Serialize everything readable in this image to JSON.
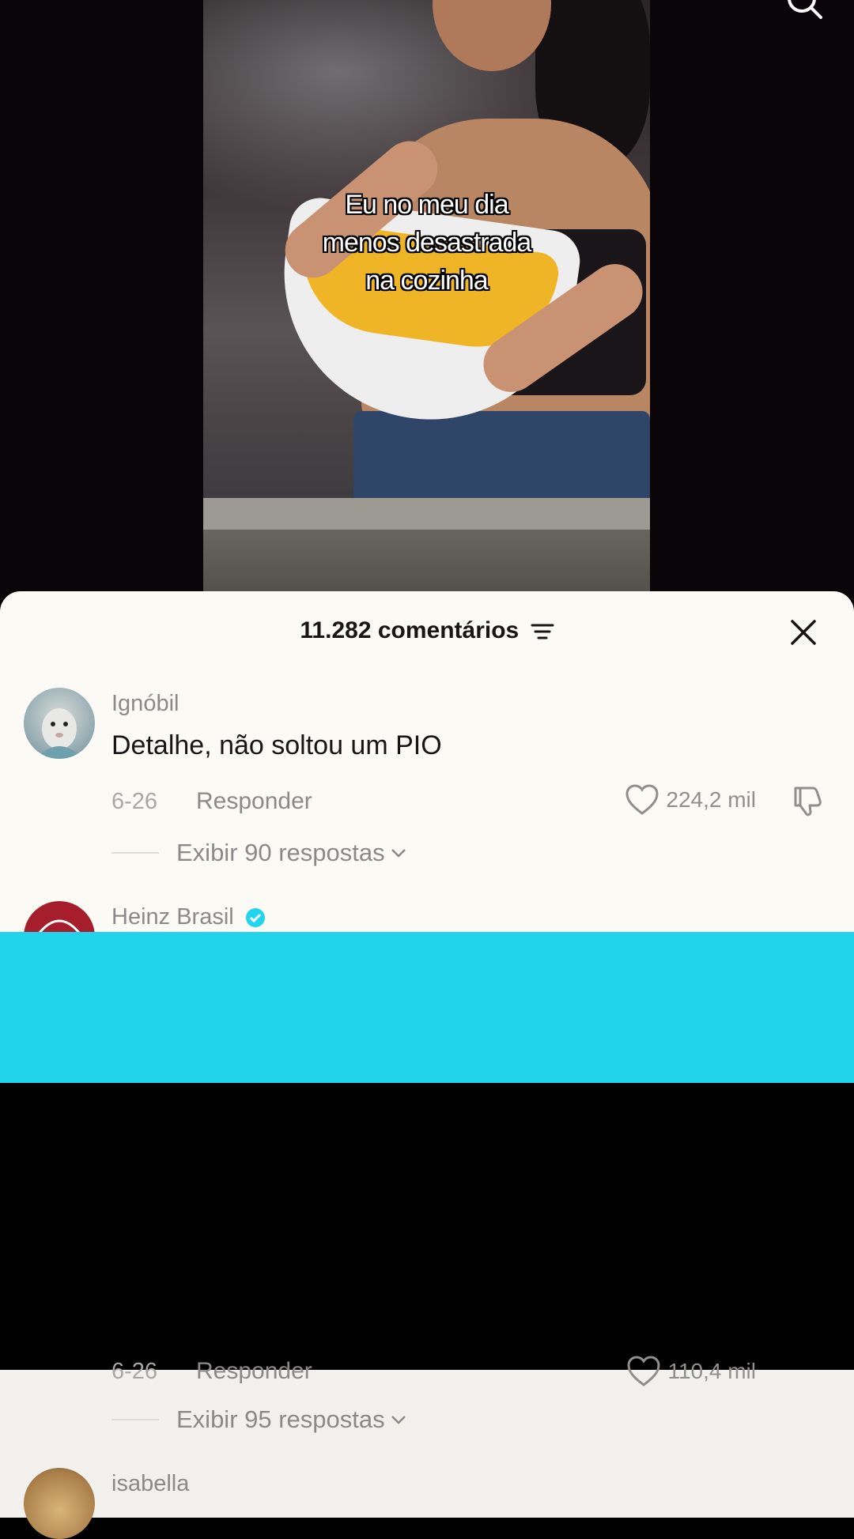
{
  "video": {
    "caption": "Eu no meu dia\nmenos desastrada\nna cozinha"
  },
  "comments_sheet": {
    "title": "11.282 comentários",
    "comments": [
      {
        "author": "Ignóbil",
        "text": "Detalhe, não soltou um PIO",
        "date": "6-26",
        "reply_label": "Responder",
        "likes": "224,2 mil",
        "view_replies": "Exibir 90 respostas"
      },
      {
        "author": "Heinz Brasil",
        "verified": true,
        "date": "6-26",
        "reply_label": "Responder",
        "likes": "110,4 mil",
        "view_replies": "Exibir 95 respostas"
      },
      {
        "author": "isabella"
      }
    ]
  },
  "colors": {
    "ad_banner": "#22d3ec",
    "sheet_bg": "#fbfaf5",
    "verified": "#20d5ec"
  },
  "icons": [
    "search-icon",
    "filter-icon",
    "close-icon",
    "heart-icon",
    "dislike-icon",
    "chevron-down-icon",
    "verified-icon"
  ]
}
